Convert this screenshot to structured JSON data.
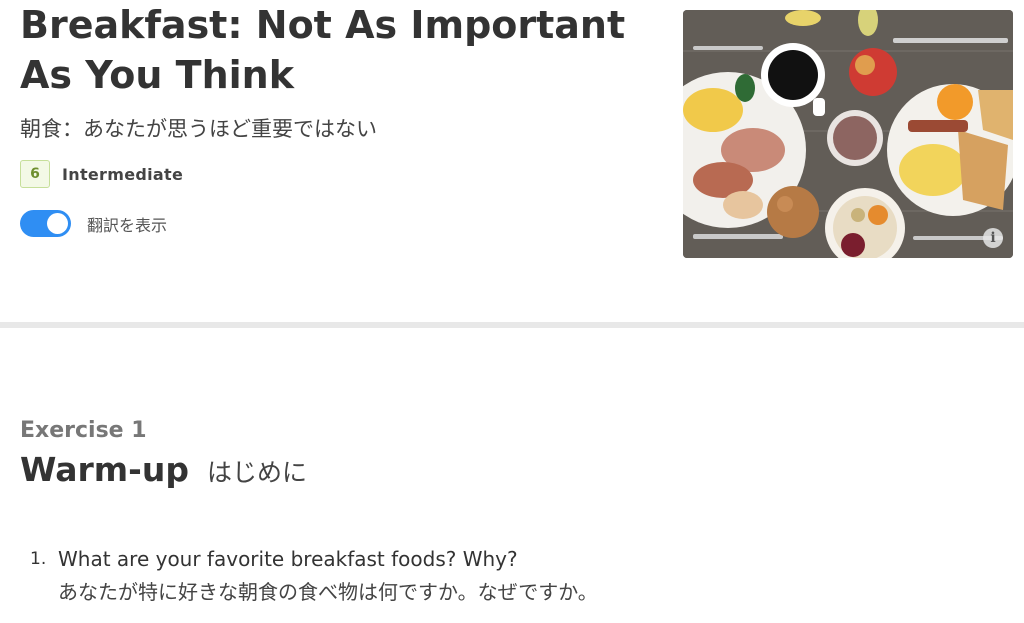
{
  "lesson": {
    "title": "Breakfast: Not As Important As You Think",
    "subtitle_jp": "朝食：あなたが思うほど重要ではない",
    "level_number": "6",
    "level_label": "Intermediate",
    "translation_toggle_label": "翻訳を表示",
    "translation_toggle_on": true,
    "info_icon_glyph": "i"
  },
  "colors": {
    "toggle_on": "#2f8ef3",
    "level_badge_border": "#c6df9a",
    "level_badge_text": "#6e8f2f"
  },
  "exercise": {
    "label": "Exercise 1",
    "title": "Warm-up",
    "title_jp": "はじめに",
    "questions": [
      {
        "number": "1.",
        "text": "What are your favorite breakfast foods? Why?",
        "translation": "あなたが特に好きな朝食の食べ物は何ですか。なぜですか。"
      }
    ]
  }
}
